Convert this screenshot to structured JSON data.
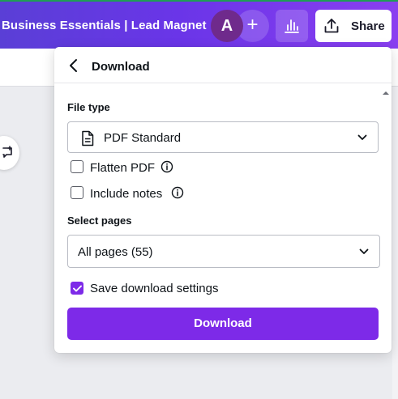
{
  "header": {
    "doc_title": "Business Essentials | Lead Magnet",
    "avatar_initial": "A",
    "add_label": "+",
    "share_label": "Share"
  },
  "panel": {
    "title": "Download",
    "file_type": {
      "label": "File type",
      "value": "PDF Standard"
    },
    "options": {
      "flatten_label": "Flatten PDF",
      "flatten_checked": false,
      "notes_label": "Include notes",
      "notes_checked": false
    },
    "pages": {
      "label": "Select pages",
      "value": "All pages (55)"
    },
    "save_settings": {
      "label": "Save download settings",
      "checked": true
    },
    "download_label": "Download"
  },
  "colors": {
    "header_gradient_start": "#5a3fd6",
    "header_gradient_end": "#8a3ff0",
    "accent": "#7d2ae8",
    "avatar": "#6f2a8c"
  }
}
